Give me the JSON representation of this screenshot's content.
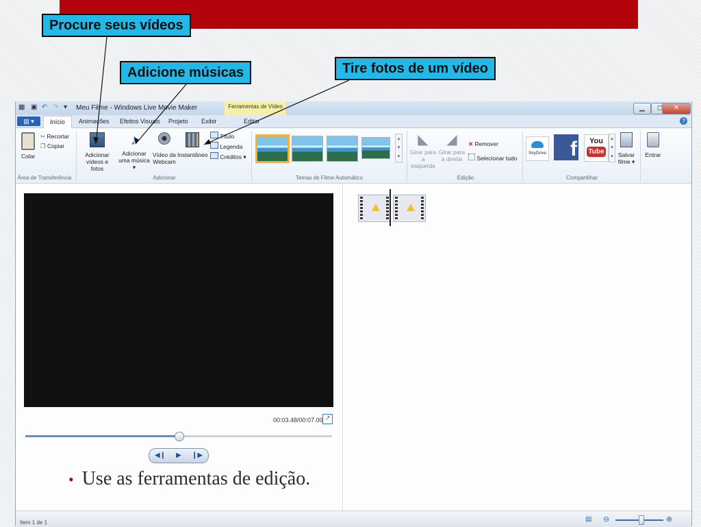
{
  "callouts": {
    "browse": "Procure seus vídeos",
    "music": "Adicione músicas",
    "snapshot": "Tire fotos de um vídeo"
  },
  "window": {
    "title": "Meu Filme - Windows Live Movie Maker",
    "context_tab": "Ferramentas de Vídeo"
  },
  "tabs": {
    "file": "▤ ▾",
    "items": [
      "Início",
      "Animações",
      "Efeitos Visuais",
      "Projeto",
      "Exibir",
      "Editar"
    ]
  },
  "ribbon": {
    "clipboard": {
      "paste": "Colar",
      "cut": "Recortar",
      "copy": "Copiar",
      "label": "Área de Transferência"
    },
    "add": {
      "add_videos_1": "Adicionar",
      "add_videos_2": "vídeos e fotos",
      "add_music_1": "Adicionar",
      "add_music_2": "uma música ▾",
      "webcam_1": "Vídeo da",
      "webcam_2": "Webcam",
      "snapshot": "Instantâneo",
      "title": "Título",
      "caption": "Legenda",
      "credits": "Créditos ▾",
      "label": "Adicionar"
    },
    "themes": {
      "label": "Temas de Filme Automático"
    },
    "editing": {
      "rotate_left_1": "Girar para",
      "rotate_left_2": "a esquerda",
      "rotate_right_1": "Girar para",
      "rotate_right_2": "a direita",
      "remove": "Remover",
      "select_all": "Selecionar tudo",
      "label": "Edição"
    },
    "share": {
      "skydrive": "SkyDrive",
      "facebook": "f",
      "youtube_top": "You",
      "youtube_bottom": "Tube",
      "save_1": "Salvar",
      "save_2": "filme ▾",
      "signin": "Entrar",
      "label": "Compartilhar"
    }
  },
  "player": {
    "time": "00:03.48/00:07.00",
    "progress": 0.5,
    "prev": "◀❙",
    "play": "▶",
    "next": "❙▶"
  },
  "status": {
    "text": "Item 1 de 1"
  },
  "bullet": {
    "text": "Use as ferramentas de edição."
  },
  "colors": {
    "banner": "#b3030b",
    "callout": "#22b8e8",
    "accent": "#2a62b6"
  }
}
